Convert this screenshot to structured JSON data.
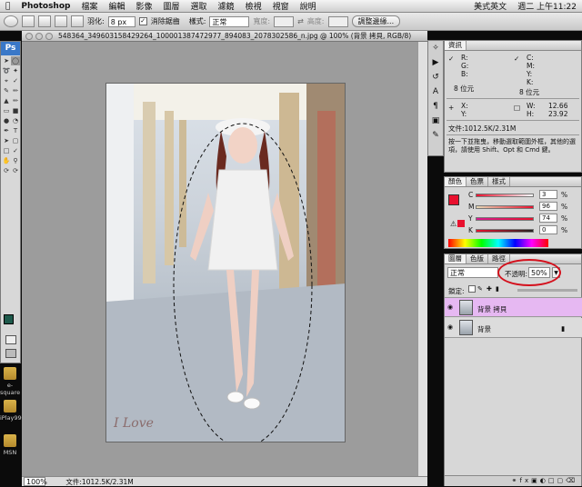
{
  "menubar": {
    "apple": "",
    "app": "Photoshop",
    "items": [
      "檔案",
      "編輯",
      "影像",
      "圖層",
      "選取",
      "濾鏡",
      "檢視",
      "視窗",
      "說明"
    ],
    "input_method": "美式英文",
    "clock": "週二 上午11:22"
  },
  "options": {
    "feather_label": "羽化:",
    "feather_value": "8 px",
    "antialias_label": "消除鋸齒",
    "style_label": "樣式:",
    "style_value": "正常",
    "width_label": "寬度:",
    "height_label": "高度:",
    "refine_label": "調整邊緣..."
  },
  "document": {
    "title": "548364_349603158429264_100001387472977_894083_2078302586_n.jpg @ 100% (背景 拷貝, RGB/8)",
    "zoom": "100%",
    "file_info": "文件:1012.5K/2.31M",
    "signature": "I Love"
  },
  "info_panel": {
    "tab": "資訊",
    "r": "R:",
    "g": "G:",
    "b": "B:",
    "c": "C:",
    "m": "M:",
    "y": "Y:",
    "k": "K:",
    "bit_left": "8 位元",
    "bit_right": "8 位元",
    "x": "X:",
    "y2": "Y:",
    "w": "W:",
    "h": "H:",
    "w_value": "12.66",
    "h_value": "23.92",
    "file": "文件:1012.5K/2.31M",
    "hint": "按一下並拖曳，移動選取範圍外框，其他的選項，請使用 Shift、Opt 和 Cmd 鍵。"
  },
  "color_panel": {
    "tabs": [
      "顏色",
      "色票",
      "樣式"
    ],
    "c_label": "C",
    "c_value": "3",
    "m_label": "M",
    "m_value": "96",
    "y_label": "Y",
    "y_value": "74",
    "k_label": "K",
    "k_value": "0",
    "pct": "%",
    "fg_color": "#e8102e"
  },
  "layers_panel": {
    "tabs": [
      "圖層",
      "色版",
      "路徑"
    ],
    "blend": "正常",
    "opacity_label": "不透明:",
    "opacity_value": "50%",
    "lock_label": "鎖定:",
    "layers": [
      {
        "name": "背景 拷貝",
        "selected": true
      },
      {
        "name": "背景",
        "selected": false
      }
    ]
  },
  "desktop": {
    "icons": [
      "e-square",
      "iPlay99",
      "MSN"
    ]
  },
  "colors": {
    "highlight_layer": "#e6b8f2",
    "annotation": "#d4101c"
  }
}
